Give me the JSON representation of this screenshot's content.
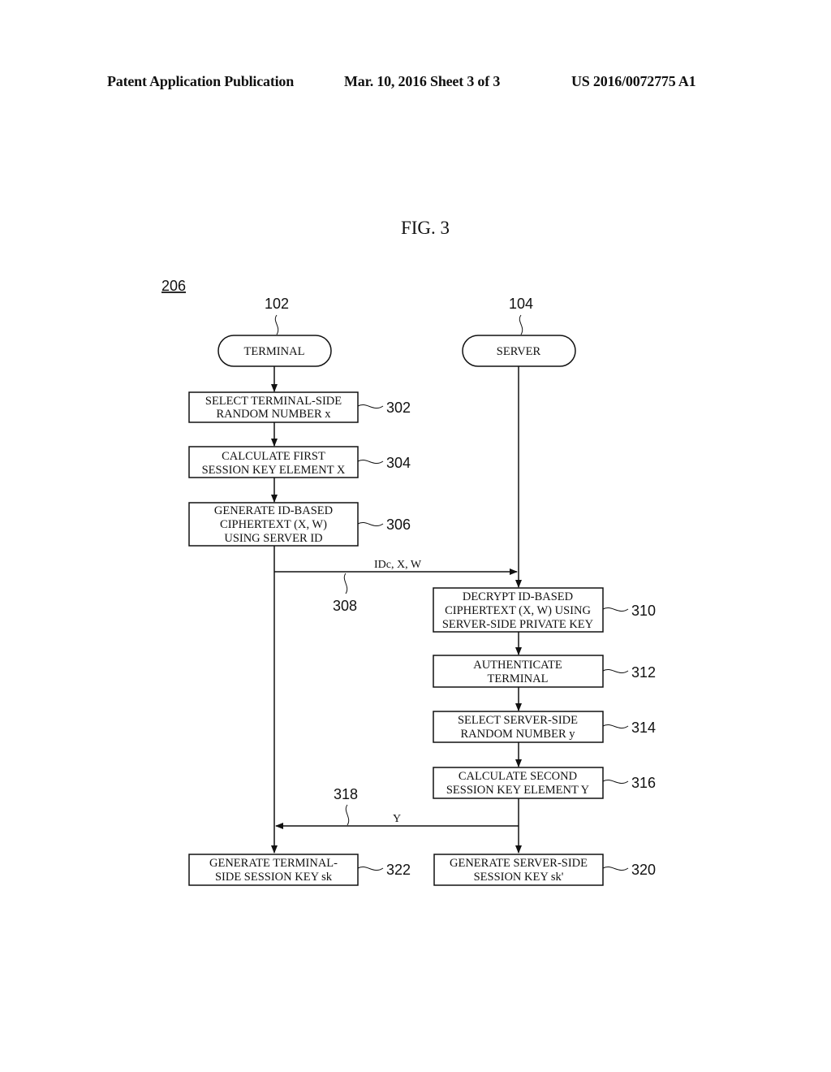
{
  "header": {
    "publication": "Patent Application Publication",
    "date_sheet": "Mar. 10, 2016  Sheet 3 of 3",
    "pub_number": "US 2016/0072775 A1"
  },
  "figure": {
    "title": "FIG. 3",
    "ref": "206"
  },
  "entities": {
    "terminal": {
      "label": "TERMINAL",
      "ref": "102"
    },
    "server": {
      "label": "SERVER",
      "ref": "104"
    }
  },
  "steps": {
    "s302": {
      "ref": "302",
      "lines": [
        "SELECT TERMINAL-SIDE",
        "RANDOM NUMBER x"
      ]
    },
    "s304": {
      "ref": "304",
      "lines": [
        "CALCULATE FIRST",
        "SESSION KEY ELEMENT X"
      ]
    },
    "s306": {
      "ref": "306",
      "lines": [
        "GENERATE ID-BASED",
        "CIPHERTEXT (X, W)",
        "USING SERVER ID"
      ]
    },
    "s310": {
      "ref": "310",
      "lines": [
        "DECRYPT ID-BASED",
        "CIPHERTEXT (X, W) USING",
        "SERVER-SIDE PRIVATE KEY"
      ]
    },
    "s312": {
      "ref": "312",
      "lines": [
        "AUTHENTICATE",
        "TERMINAL"
      ]
    },
    "s314": {
      "ref": "314",
      "lines": [
        "SELECT SERVER-SIDE",
        "RANDOM NUMBER y"
      ]
    },
    "s316": {
      "ref": "316",
      "lines": [
        "CALCULATE SECOND",
        "SESSION KEY ELEMENT Y"
      ]
    },
    "s320": {
      "ref": "320",
      "lines": [
        "GENERATE SERVER-SIDE",
        "SESSION KEY sk'"
      ]
    },
    "s322": {
      "ref": "322",
      "lines": [
        "GENERATE TERMINAL-",
        "SIDE SESSION KEY sk"
      ]
    }
  },
  "messages": {
    "m308": {
      "ref": "308",
      "label": "IDc, X, W"
    },
    "m318": {
      "ref": "318",
      "label": "Y"
    }
  }
}
